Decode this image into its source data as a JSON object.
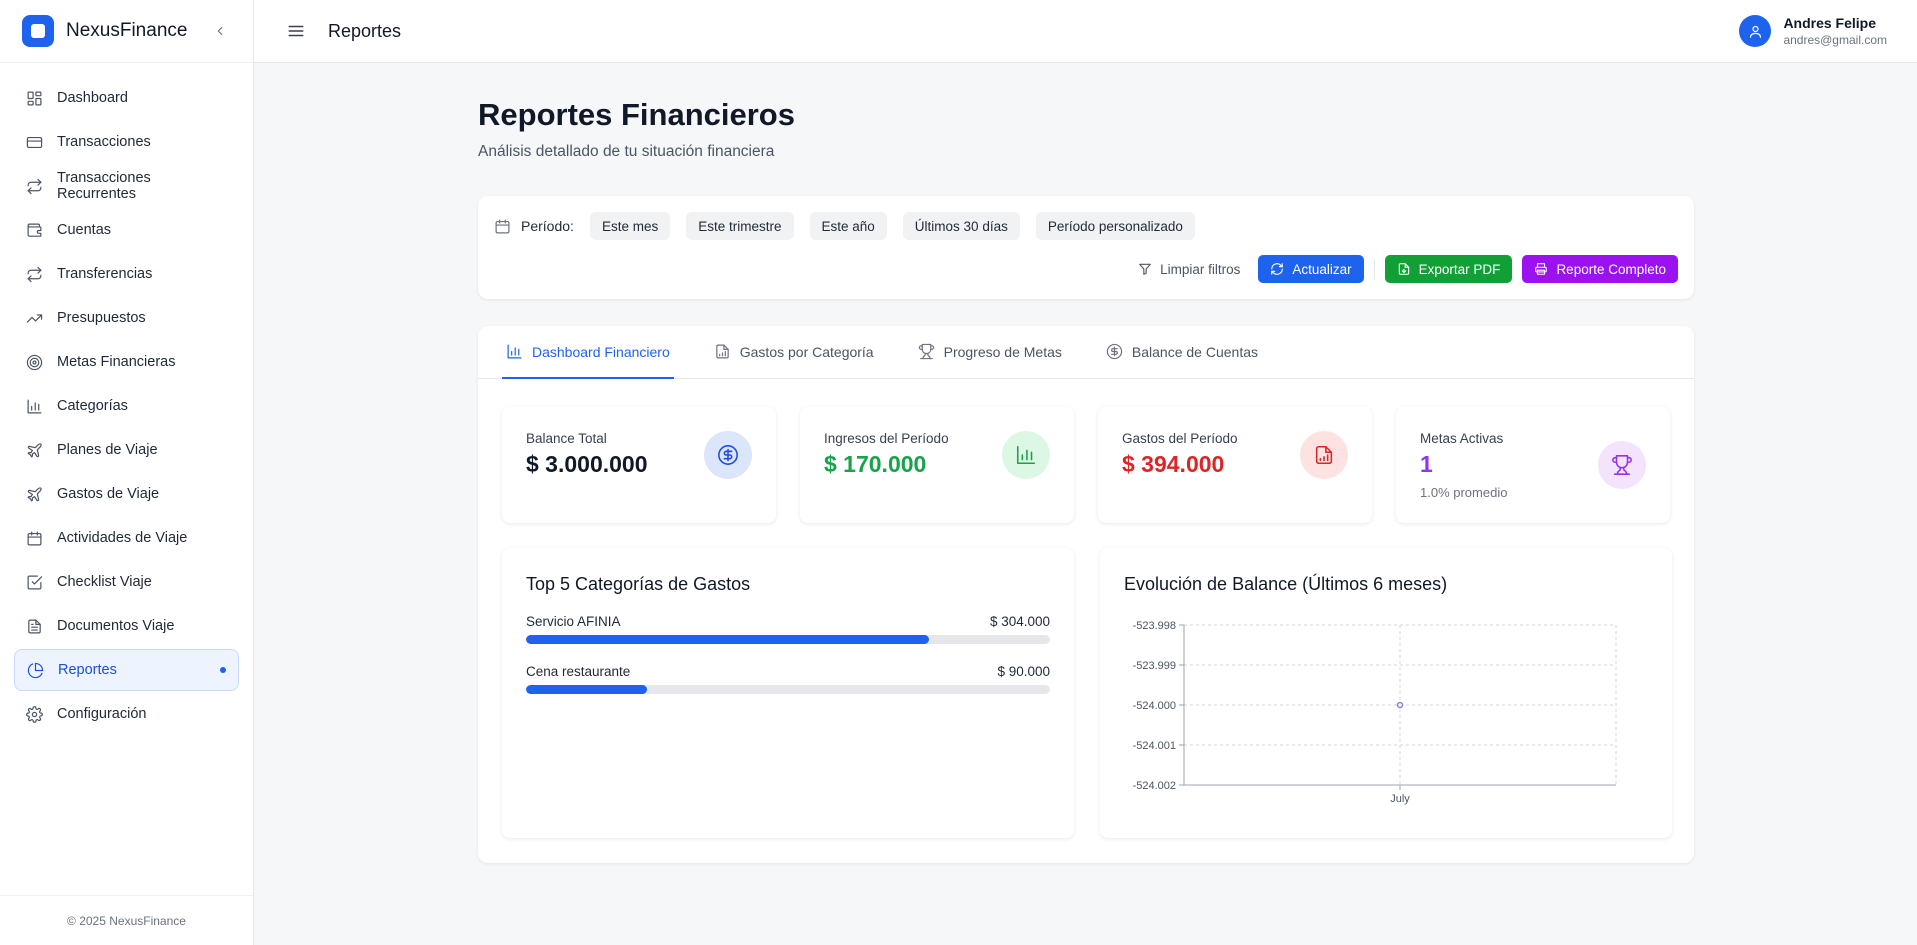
{
  "sidebar": {
    "brand": "NexusFinance",
    "items": [
      {
        "label": "Dashboard",
        "icon": "layout-grid-icon",
        "name": "sidebar-item-dashboard"
      },
      {
        "label": "Transacciones",
        "icon": "credit-card-icon",
        "name": "sidebar-item-transacciones"
      },
      {
        "label": "Transacciones Recurrentes",
        "icon": "repeat-icon",
        "name": "sidebar-item-transacciones-recurrentes"
      },
      {
        "label": "Cuentas",
        "icon": "wallet-icon",
        "name": "sidebar-item-cuentas"
      },
      {
        "label": "Transferencias",
        "icon": "transfer-icon",
        "name": "sidebar-item-transferencias"
      },
      {
        "label": "Presupuestos",
        "icon": "trending-up-icon",
        "name": "sidebar-item-presupuestos"
      },
      {
        "label": "Metas Financieras",
        "icon": "target-icon",
        "name": "sidebar-item-metas-financieras"
      },
      {
        "label": "Categorías",
        "icon": "bar-chart-icon",
        "name": "sidebar-item-categorias"
      },
      {
        "label": "Planes de Viaje",
        "icon": "plane-icon",
        "name": "sidebar-item-planes-de-viaje"
      },
      {
        "label": "Gastos de Viaje",
        "icon": "plane-icon",
        "name": "sidebar-item-gastos-de-viaje"
      },
      {
        "label": "Actividades de Viaje",
        "icon": "calendar-icon",
        "name": "sidebar-item-actividades-de-viaje"
      },
      {
        "label": "Checklist Viaje",
        "icon": "checkbox-icon",
        "name": "sidebar-item-checklist-viaje"
      },
      {
        "label": "Documentos Viaje",
        "icon": "file-text-icon",
        "name": "sidebar-item-documentos-viaje"
      },
      {
        "label": "Reportes",
        "icon": "pie-chart-icon",
        "name": "sidebar-item-reportes",
        "active": true
      },
      {
        "label": "Configuración",
        "icon": "gear-icon",
        "name": "sidebar-item-configuracion"
      }
    ],
    "footer": "© 2025 NexusFinance"
  },
  "topbar": {
    "title": "Reportes",
    "user_name": "Andres Felipe",
    "user_email": "andres@gmail.com"
  },
  "page": {
    "title": "Reportes Financieros",
    "subtitle": "Análisis detallado de tu situación financiera"
  },
  "filters": {
    "period_label": "Período:",
    "periods": [
      "Este mes",
      "Este trimestre",
      "Este año",
      "Últimos 30 días",
      "Período personalizado"
    ],
    "clear_label": "Limpiar filtros",
    "refresh_label": "Actualizar",
    "export_label": "Exportar PDF",
    "full_report_label": "Reporte Completo"
  },
  "tabs": [
    {
      "label": "Dashboard Financiero",
      "icon": "bar-chart-icon",
      "active": true
    },
    {
      "label": "Gastos por Categoría",
      "icon": "file-chart-icon"
    },
    {
      "label": "Progreso de Metas",
      "icon": "trophy-icon"
    },
    {
      "label": "Balance de Cuentas",
      "icon": "dollar-circle-icon"
    }
  ],
  "stats": [
    {
      "label": "Balance Total",
      "value": "$ 3.000.000",
      "color": "#111827",
      "icon": "dollar-circle-icon",
      "icon_bg": "#dbe6fb",
      "icon_color": "#1d4ed8"
    },
    {
      "label": "Ingresos del Período",
      "value": "$ 170.000",
      "color": "#16a34a",
      "icon": "bar-chart-icon",
      "icon_bg": "#dcf7e4",
      "icon_color": "#16a34a"
    },
    {
      "label": "Gastos del Período",
      "value": "$ 394.000",
      "color": "#dc2626",
      "icon": "file-chart-icon",
      "icon_bg": "#fde2e2",
      "icon_color": "#dc2626"
    },
    {
      "label": "Metas Activas",
      "value": "1",
      "sub": "1.0% promedio",
      "color": "#9333ea",
      "icon": "trophy-icon",
      "icon_bg": "#f3e3fd",
      "icon_color": "#9333ea"
    }
  ],
  "top_categories": {
    "title": "Top 5 Categorías de Gastos",
    "items": [
      {
        "name": "Servicio AFINIA",
        "amount": "$ 304.000",
        "share": 0.77
      },
      {
        "name": "Cena restaurante",
        "amount": "$ 90.000",
        "share": 0.23
      }
    ]
  },
  "balance_chart": {
    "title": "Evolución de Balance (Últimos 6 meses)"
  },
  "chart_data": {
    "type": "line",
    "title": "Evolución de Balance (Últimos 6 meses)",
    "xlabel": "",
    "ylabel": "",
    "x": [
      "July"
    ],
    "series": [
      {
        "values": [
          -524.0
        ]
      }
    ],
    "ylim": [
      -524.002,
      -523.998
    ],
    "yticks": [
      "-523.998",
      "-523.999",
      "-524.000",
      "-524.001",
      "-524.002"
    ],
    "grid": true,
    "point_color": "#8b7fd6"
  }
}
